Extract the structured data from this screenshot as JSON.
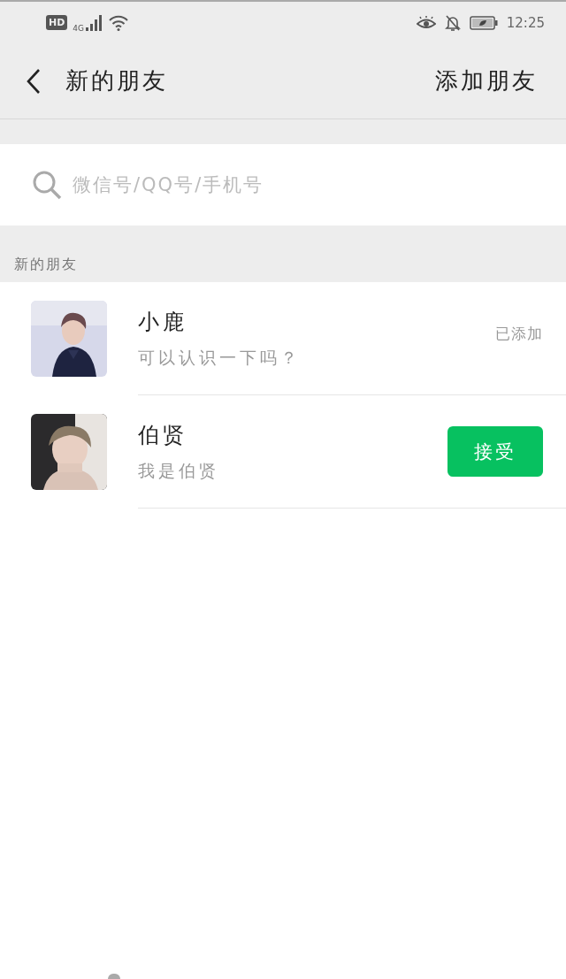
{
  "status_bar": {
    "hd": "HD",
    "network": "4G",
    "time": "12:25"
  },
  "header": {
    "title": "新的朋友",
    "action": "添加朋友"
  },
  "search": {
    "placeholder": "微信号/QQ号/手机号"
  },
  "section": {
    "title": "新的朋友"
  },
  "requests": [
    {
      "name": "小鹿",
      "message": "可以认识一下吗？",
      "kind": "added",
      "status": "已添加"
    },
    {
      "name": "伯贤",
      "message": "我是伯贤",
      "kind": "pending",
      "button": "接受"
    }
  ]
}
